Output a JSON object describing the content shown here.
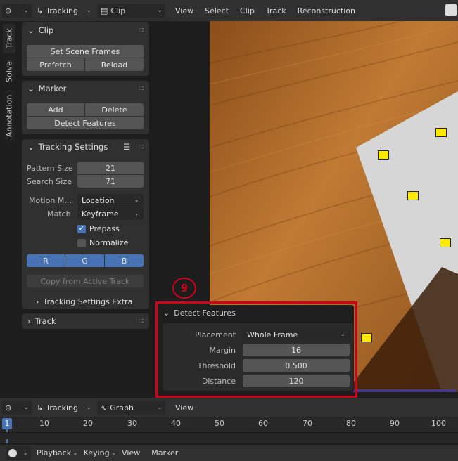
{
  "top_header": {
    "mode": "Tracking",
    "clip": "Clip",
    "menus": [
      "View",
      "Select",
      "Clip",
      "Track",
      "Reconstruction"
    ]
  },
  "side_tabs": [
    "Track",
    "Solve",
    "Annotation"
  ],
  "clip_panel": {
    "title": "Clip",
    "set_scene_frames": "Set Scene Frames",
    "prefetch": "Prefetch",
    "reload": "Reload"
  },
  "marker_panel": {
    "title": "Marker",
    "add": "Add",
    "delete": "Delete",
    "detect_features": "Detect Features"
  },
  "tracking_settings": {
    "title": "Tracking Settings",
    "pattern_size_label": "Pattern Size",
    "pattern_size": "21",
    "search_size_label": "Search Size",
    "search_size": "71",
    "motion_model_label": "Motion M...",
    "motion_model": "Location",
    "match_label": "Match",
    "match": "Keyframe",
    "prepass": "Prepass",
    "prepass_checked": true,
    "normalize": "Normalize",
    "normalize_checked": false,
    "channels": [
      "R",
      "G",
      "B"
    ],
    "copy_from_active": "Copy from Active Track",
    "extra": "Tracking Settings Extra"
  },
  "track_panel": {
    "title": "Track"
  },
  "annotation_badge": "9",
  "detect_popup": {
    "title": "Detect Features",
    "placement_label": "Placement",
    "placement": "Whole Frame",
    "margin_label": "Margin",
    "margin": "16",
    "threshold_label": "Threshold",
    "threshold": "0.500",
    "distance_label": "Distance",
    "distance": "120"
  },
  "graph_header": {
    "mode": "Tracking",
    "view_type": "Graph",
    "menus": [
      "View"
    ]
  },
  "timeline": {
    "current_frame": "1",
    "ticks": [
      "10",
      "20",
      "30",
      "40",
      "50",
      "60",
      "70",
      "80",
      "90",
      "100"
    ]
  },
  "bottom_bar": {
    "menus": [
      "Playback",
      "Keying",
      "View",
      "Marker"
    ]
  },
  "colors": {
    "accent_blue": "#4772b3",
    "annotation_red": "#d0021b",
    "marker_yellow": "#ffea00"
  }
}
